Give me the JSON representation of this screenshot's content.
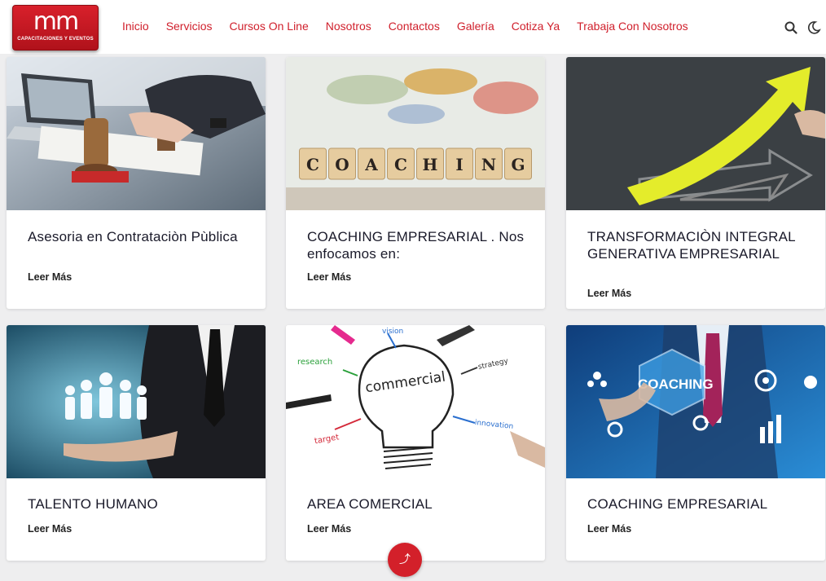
{
  "brand": {
    "logo_text": "mm",
    "logo_subtitle": "CAPACITACIONES Y EVENTOS"
  },
  "nav": {
    "links": [
      "Inicio",
      "Servicios",
      "Cursos On Line",
      "Nosotros",
      "Contactos",
      "Galería",
      "Cotiza Ya",
      "Trabaja Con Nosotros"
    ],
    "search_icon": "search-icon",
    "theme_icon": "moon-icon"
  },
  "cards": [
    {
      "title": "Asesoria en Contrataciòn Pùblica",
      "link": "Leer Más"
    },
    {
      "title": "COACHING EMPRESARIAL . Nos enfocamos en:",
      "link": "Leer Más",
      "image_text": "COACHING"
    },
    {
      "title": "TRANSFORMACIÒN INTEGRAL GENERATIVA EMPRESARIAL",
      "link": "Leer Más"
    },
    {
      "title": "TALENTO HUMANO",
      "link": "Leer Más"
    },
    {
      "title": "AREA COMERCIAL",
      "link": "Leer Más",
      "image_words": [
        "vision",
        "research",
        "strategy",
        "commercial",
        "target",
        "innovation"
      ]
    },
    {
      "title": "COACHING EMPRESARIAL",
      "link": "Leer Más",
      "image_text": "COACHING"
    }
  ],
  "colors": {
    "accent": "#d3202a",
    "page_bg": "#eeeeef"
  }
}
